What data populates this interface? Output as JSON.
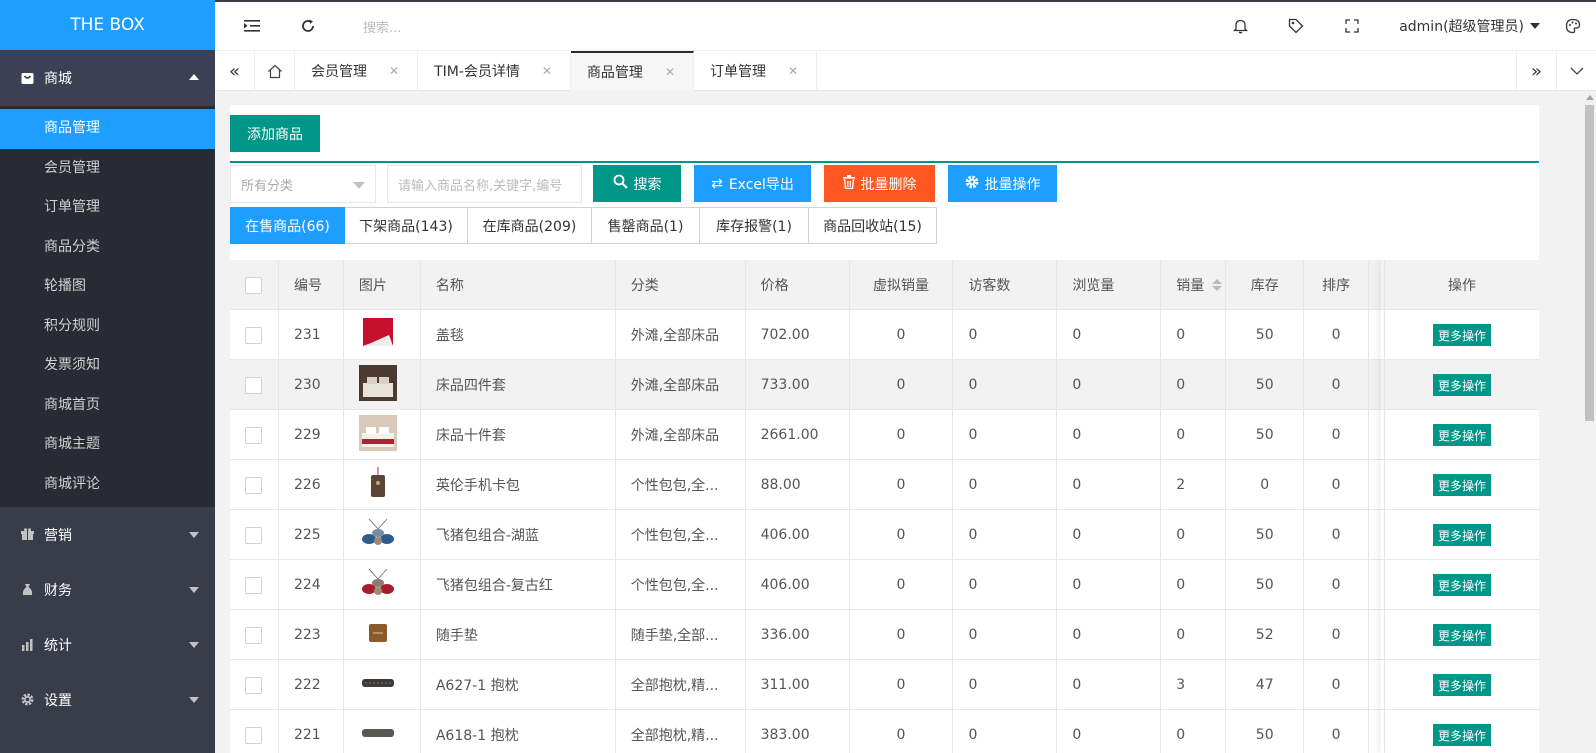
{
  "sidebar": {
    "logo": "THE BOX",
    "groups": [
      {
        "label": "商城",
        "icon": "shop-icon"
      },
      {
        "label": "营销",
        "icon": "gift-icon"
      },
      {
        "label": "财务",
        "icon": "money-bag-icon"
      },
      {
        "label": "统计",
        "icon": "bar-chart-icon"
      },
      {
        "label": "设置",
        "icon": "gear-icon"
      }
    ],
    "items": [
      "商品管理",
      "会员管理",
      "订单管理",
      "商品分类",
      "轮播图",
      "积分规则",
      "发票须知",
      "商城首页",
      "商城主题",
      "商城评论"
    ]
  },
  "header": {
    "search_placeholder": "搜索...",
    "user": "admin(超级管理员)"
  },
  "tabs": [
    {
      "label": "会员管理"
    },
    {
      "label": "TIM-会员详情"
    },
    {
      "label": "商品管理"
    },
    {
      "label": "订单管理"
    }
  ],
  "toolbar": {
    "add_label": "添加商品",
    "category_placeholder": "所有分类",
    "keyword_placeholder": "请输入商品名称,关键字,编号",
    "search_label": "搜索",
    "excel_label": "Excel导出",
    "delete_label": "批量删除",
    "batch_label": "批量操作"
  },
  "filter_tabs": [
    "在售商品(66)",
    "下架商品(143)",
    "在库商品(209)",
    "售罄商品(1)",
    "库存报警(1)",
    "商品回收站(15)"
  ],
  "table": {
    "columns": [
      "编号",
      "图片",
      "名称",
      "分类",
      "价格",
      "虚拟销量",
      "访客数",
      "浏览量",
      "销量",
      "库存",
      "排序",
      "操作"
    ],
    "action_label": "更多操作",
    "rows": [
      {
        "id": "231",
        "name": "盖毯",
        "category": "外滩,全部床品",
        "price": "702.00",
        "virtual": "0",
        "visitors": "0",
        "views": "0",
        "sales": "0",
        "stock": "50",
        "sort": "0"
      },
      {
        "id": "230",
        "name": "床品四件套",
        "category": "外滩,全部床品",
        "price": "733.00",
        "virtual": "0",
        "visitors": "0",
        "views": "0",
        "sales": "0",
        "stock": "50",
        "sort": "0"
      },
      {
        "id": "229",
        "name": "床品十件套",
        "category": "外滩,全部床品",
        "price": "2661.00",
        "virtual": "0",
        "visitors": "0",
        "views": "0",
        "sales": "0",
        "stock": "50",
        "sort": "0"
      },
      {
        "id": "226",
        "name": "英伦手机卡包",
        "category": "个性包包,全...",
        "price": "88.00",
        "virtual": "0",
        "visitors": "0",
        "views": "0",
        "sales": "2",
        "stock": "0",
        "sort": "0"
      },
      {
        "id": "225",
        "name": "飞猪包组合-湖蓝",
        "category": "个性包包,全...",
        "price": "406.00",
        "virtual": "0",
        "visitors": "0",
        "views": "0",
        "sales": "0",
        "stock": "50",
        "sort": "0"
      },
      {
        "id": "224",
        "name": "飞猪包组合-复古红",
        "category": "个性包包,全...",
        "price": "406.00",
        "virtual": "0",
        "visitors": "0",
        "views": "0",
        "sales": "0",
        "stock": "50",
        "sort": "0"
      },
      {
        "id": "223",
        "name": "随手垫",
        "category": "随手垫,全部...",
        "price": "336.00",
        "virtual": "0",
        "visitors": "0",
        "views": "0",
        "sales": "0",
        "stock": "52",
        "sort": "0"
      },
      {
        "id": "222",
        "name": "A627-1 抱枕",
        "category": "全部抱枕,精...",
        "price": "311.00",
        "virtual": "0",
        "visitors": "0",
        "views": "0",
        "sales": "3",
        "stock": "47",
        "sort": "0"
      },
      {
        "id": "221",
        "name": "A618-1 抱枕",
        "category": "全部抱枕,精...",
        "price": "383.00",
        "virtual": "0",
        "visitors": "0",
        "views": "0",
        "sales": "0",
        "stock": "50",
        "sort": "0"
      }
    ]
  },
  "colors": {
    "primary": "#009688",
    "blue": "#1E9FFF",
    "danger": "#FF5722",
    "sidebar": "#393D49"
  }
}
